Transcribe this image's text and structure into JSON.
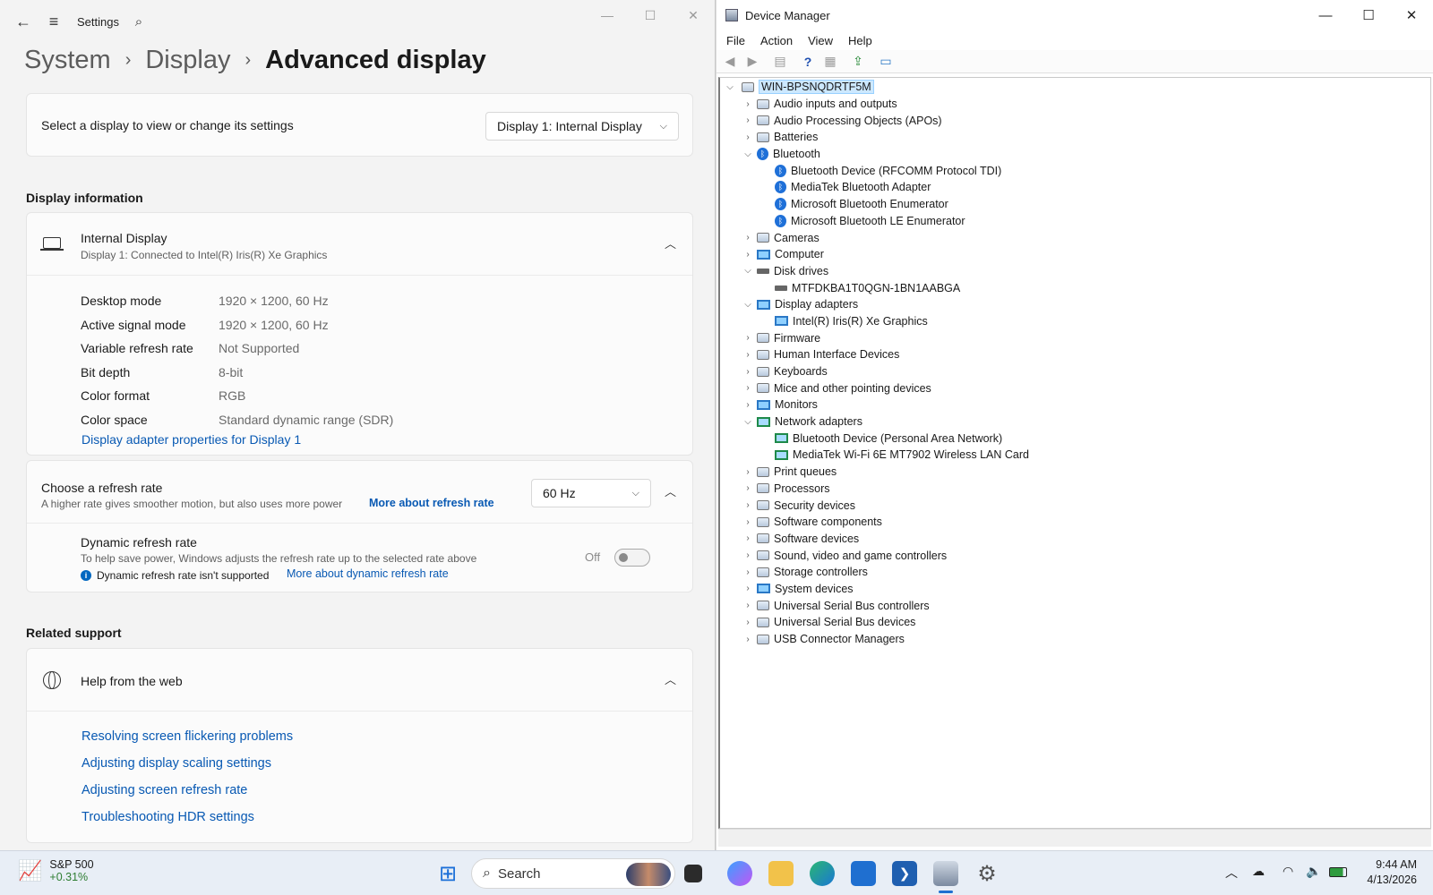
{
  "settings": {
    "app_title": "Settings",
    "breadcrumb": [
      "System",
      "Display",
      "Advanced display"
    ],
    "select_display": {
      "label": "Select a display to view or change its settings",
      "value": "Display 1: Internal Display"
    },
    "display_info": {
      "section_title": "Display information",
      "display_name": "Internal Display",
      "display_sub": "Display 1: Connected to Intel(R) Iris(R) Xe Graphics",
      "rows": [
        {
          "key": "Desktop mode",
          "value": "1920 × 1200, 60 Hz"
        },
        {
          "key": "Active signal mode",
          "value": "1920 × 1200, 60 Hz"
        },
        {
          "key": "Variable refresh rate",
          "value": "Not Supported"
        },
        {
          "key": "Bit depth",
          "value": "8-bit"
        },
        {
          "key": "Color format",
          "value": "RGB"
        },
        {
          "key": "Color space",
          "value": "Standard dynamic range (SDR)"
        }
      ],
      "adapter_link": "Display adapter properties for Display 1"
    },
    "refresh": {
      "title": "Choose a refresh rate",
      "sub": "A higher rate gives smoother motion, but also uses more power",
      "link": "More about refresh rate",
      "value": "60 Hz",
      "dynamic_title": "Dynamic refresh rate",
      "dynamic_sub": "To help save power, Windows adjusts the refresh rate up to the selected rate above",
      "dynamic_note": "Dynamic refresh rate isn't supported",
      "dynamic_link": "More about dynamic refresh rate",
      "toggle_state": "Off"
    },
    "related": {
      "section_title": "Related support",
      "help_title": "Help from the web",
      "links": [
        "Resolving screen flickering problems",
        "Adjusting display scaling settings",
        "Adjusting screen refresh rate",
        "Troubleshooting HDR settings"
      ]
    }
  },
  "devmgr": {
    "title": "Device Manager",
    "menu": [
      "File",
      "Action",
      "View",
      "Help"
    ],
    "root": "WIN-BPSNQDRTF5M",
    "tree": [
      {
        "label": "Audio inputs and outputs",
        "level": 1,
        "state": "collapsed",
        "icon": "speaker-icon"
      },
      {
        "label": "Audio Processing Objects (APOs)",
        "level": 1,
        "state": "collapsed",
        "icon": "speaker-icon"
      },
      {
        "label": "Batteries",
        "level": 1,
        "state": "collapsed",
        "icon": "battery-icon"
      },
      {
        "label": "Bluetooth",
        "level": 1,
        "state": "expanded",
        "icon": "bluetooth-icon"
      },
      {
        "label": "Bluetooth Device (RFCOMM Protocol TDI)",
        "level": 2,
        "state": "leaf",
        "icon": "bluetooth-icon"
      },
      {
        "label": "MediaTek Bluetooth Adapter",
        "level": 2,
        "state": "leaf",
        "icon": "bluetooth-icon"
      },
      {
        "label": "Microsoft Bluetooth Enumerator",
        "level": 2,
        "state": "leaf",
        "icon": "bluetooth-icon"
      },
      {
        "label": "Microsoft Bluetooth LE Enumerator",
        "level": 2,
        "state": "leaf",
        "icon": "bluetooth-icon"
      },
      {
        "label": "Cameras",
        "level": 1,
        "state": "collapsed",
        "icon": "camera-icon"
      },
      {
        "label": "Computer",
        "level": 1,
        "state": "collapsed",
        "icon": "monitor-icon"
      },
      {
        "label": "Disk drives",
        "level": 1,
        "state": "expanded",
        "icon": "disk-icon"
      },
      {
        "label": "MTFDKBA1T0QGN-1BN1AABGA",
        "level": 2,
        "state": "leaf",
        "icon": "disk-icon"
      },
      {
        "label": "Display adapters",
        "level": 1,
        "state": "expanded",
        "icon": "monitor-icon"
      },
      {
        "label": "Intel(R) Iris(R) Xe Graphics",
        "level": 2,
        "state": "leaf",
        "icon": "monitor-icon"
      },
      {
        "label": "Firmware",
        "level": 1,
        "state": "collapsed",
        "icon": "chip-icon"
      },
      {
        "label": "Human Interface Devices",
        "level": 1,
        "state": "collapsed",
        "icon": "hid-icon"
      },
      {
        "label": "Keyboards",
        "level": 1,
        "state": "collapsed",
        "icon": "keyboard-icon"
      },
      {
        "label": "Mice and other pointing devices",
        "level": 1,
        "state": "collapsed",
        "icon": "mouse-icon"
      },
      {
        "label": "Monitors",
        "level": 1,
        "state": "collapsed",
        "icon": "monitor-icon"
      },
      {
        "label": "Network adapters",
        "level": 1,
        "state": "expanded",
        "icon": "network-icon"
      },
      {
        "label": "Bluetooth Device (Personal Area Network)",
        "level": 2,
        "state": "leaf",
        "icon": "network-icon"
      },
      {
        "label": "MediaTek Wi-Fi 6E MT7902 Wireless LAN Card",
        "level": 2,
        "state": "leaf",
        "icon": "network-icon"
      },
      {
        "label": "Print queues",
        "level": 1,
        "state": "collapsed",
        "icon": "printer-icon"
      },
      {
        "label": "Processors",
        "level": 1,
        "state": "collapsed",
        "icon": "chip-icon"
      },
      {
        "label": "Security devices",
        "level": 1,
        "state": "collapsed",
        "icon": "key-icon"
      },
      {
        "label": "Software components",
        "level": 1,
        "state": "collapsed",
        "icon": "puzzle-icon"
      },
      {
        "label": "Software devices",
        "level": 1,
        "state": "collapsed",
        "icon": "device-icon"
      },
      {
        "label": "Sound, video and game controllers",
        "level": 1,
        "state": "collapsed",
        "icon": "speaker-icon"
      },
      {
        "label": "Storage controllers",
        "level": 1,
        "state": "collapsed",
        "icon": "storage-icon"
      },
      {
        "label": "System devices",
        "level": 1,
        "state": "collapsed",
        "icon": "monitor-icon"
      },
      {
        "label": "Universal Serial Bus controllers",
        "level": 1,
        "state": "collapsed",
        "icon": "usb-icon"
      },
      {
        "label": "Universal Serial Bus devices",
        "level": 1,
        "state": "collapsed",
        "icon": "usb-icon"
      },
      {
        "label": "USB Connector Managers",
        "level": 1,
        "state": "collapsed",
        "icon": "usb-icon"
      }
    ]
  },
  "taskbar": {
    "stock_name": "S&P 500",
    "stock_change": "+0.31%",
    "search_placeholder": "Search",
    "time": "9:44 AM",
    "date": "4/13/2026",
    "apps": [
      "start-icon",
      "task-view-icon",
      "copilot-icon",
      "file-explorer-icon",
      "edge-icon",
      "store-icon",
      "power-automate-icon",
      "device-manager-icon",
      "settings-icon"
    ]
  },
  "colors": {
    "accent_link": "#0859b3",
    "selection": "#cce8ff"
  }
}
